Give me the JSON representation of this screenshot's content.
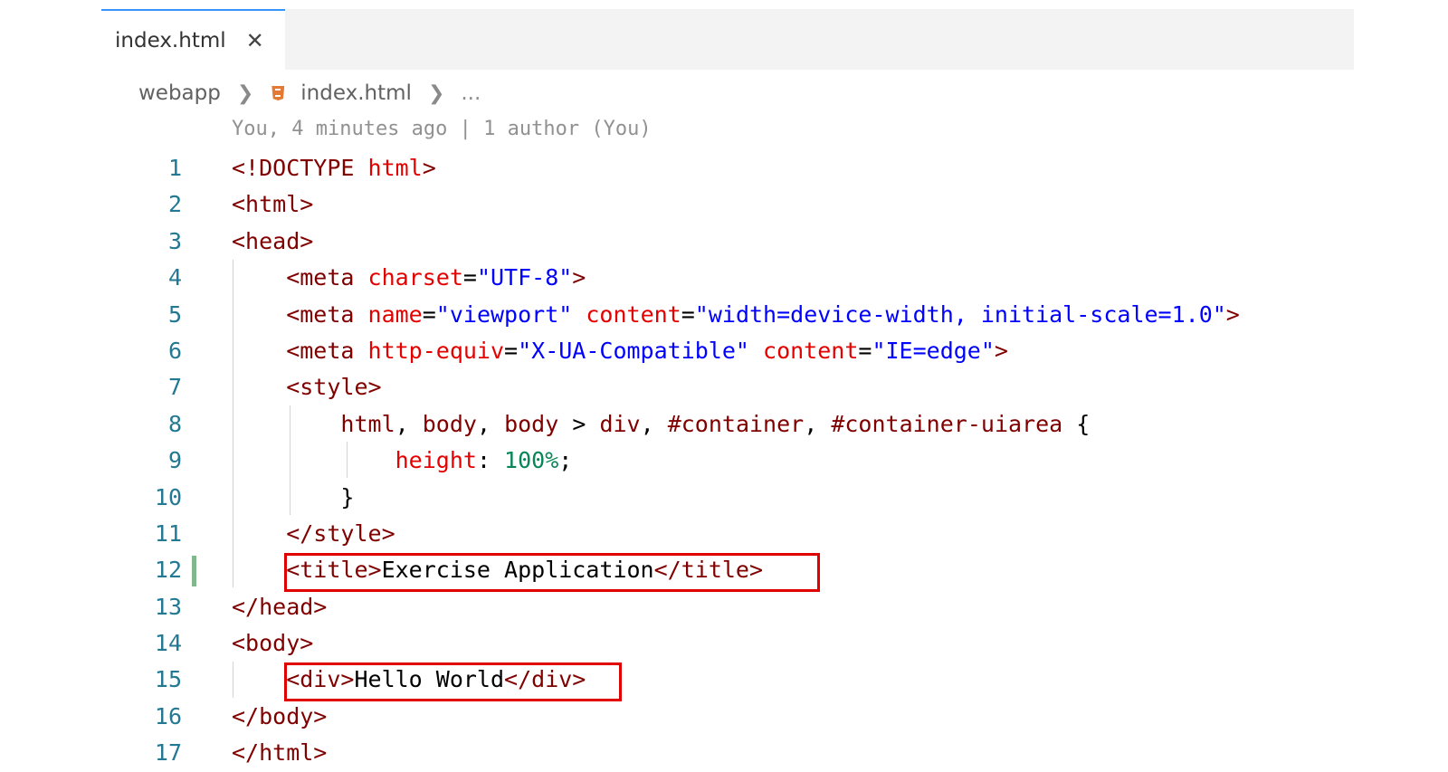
{
  "tab": {
    "label": "index.html",
    "close": "✕"
  },
  "breadcrumb": {
    "folder": "webapp",
    "file": "index.html",
    "more": "..."
  },
  "blame": "You, 4 minutes ago | 1 author (You)",
  "colors": {
    "tag": "#800000",
    "attribute": "#e50000",
    "string": "#0000ff",
    "number": "#098658",
    "line_number": "#237893",
    "highlight_box": "#e00000",
    "modified_gutter": "#81b88b",
    "active_tab_border": "#3794ff"
  },
  "lines": [
    {
      "n": "1",
      "tokens": [
        {
          "t": "<!DOCTYPE ",
          "c": "tag"
        },
        {
          "t": "html",
          "c": "attr"
        },
        {
          "t": ">",
          "c": "tag"
        }
      ]
    },
    {
      "n": "2",
      "tokens": [
        {
          "t": "<html>",
          "c": "tag"
        }
      ]
    },
    {
      "n": "3",
      "tokens": [
        {
          "t": "<head>",
          "c": "tag"
        }
      ]
    },
    {
      "n": "4",
      "tokens": [
        {
          "t": "    <meta ",
          "c": "tag"
        },
        {
          "t": "charset",
          "c": "attr"
        },
        {
          "t": "=",
          "c": "txt"
        },
        {
          "t": "\"UTF-8\"",
          "c": "str"
        },
        {
          "t": ">",
          "c": "tag"
        }
      ]
    },
    {
      "n": "5",
      "tokens": [
        {
          "t": "    <meta ",
          "c": "tag"
        },
        {
          "t": "name",
          "c": "attr"
        },
        {
          "t": "=",
          "c": "txt"
        },
        {
          "t": "\"viewport\"",
          "c": "str"
        },
        {
          "t": " ",
          "c": "txt"
        },
        {
          "t": "content",
          "c": "attr"
        },
        {
          "t": "=",
          "c": "txt"
        },
        {
          "t": "\"width=device-width, initial-scale=1.0\"",
          "c": "str"
        },
        {
          "t": ">",
          "c": "tag"
        }
      ]
    },
    {
      "n": "6",
      "tokens": [
        {
          "t": "    <meta ",
          "c": "tag"
        },
        {
          "t": "http-equiv",
          "c": "attr"
        },
        {
          "t": "=",
          "c": "txt"
        },
        {
          "t": "\"X-UA-Compatible\"",
          "c": "str"
        },
        {
          "t": " ",
          "c": "txt"
        },
        {
          "t": "content",
          "c": "attr"
        },
        {
          "t": "=",
          "c": "txt"
        },
        {
          "t": "\"IE=edge\"",
          "c": "str"
        },
        {
          "t": ">",
          "c": "tag"
        }
      ]
    },
    {
      "n": "7",
      "tokens": [
        {
          "t": "    <style>",
          "c": "tag"
        }
      ]
    },
    {
      "n": "8",
      "tokens": [
        {
          "t": "        html",
          "c": "sel"
        },
        {
          "t": ", ",
          "c": "txt"
        },
        {
          "t": "body",
          "c": "sel"
        },
        {
          "t": ", ",
          "c": "txt"
        },
        {
          "t": "body",
          "c": "sel"
        },
        {
          "t": " > ",
          "c": "txt"
        },
        {
          "t": "div",
          "c": "sel"
        },
        {
          "t": ", ",
          "c": "txt"
        },
        {
          "t": "#container",
          "c": "sel"
        },
        {
          "t": ", ",
          "c": "txt"
        },
        {
          "t": "#container-uiarea",
          "c": "sel"
        },
        {
          "t": " {",
          "c": "txt"
        }
      ]
    },
    {
      "n": "9",
      "tokens": [
        {
          "t": "            height",
          "c": "attr"
        },
        {
          "t": ": ",
          "c": "txt"
        },
        {
          "t": "100%",
          "c": "num"
        },
        {
          "t": ";",
          "c": "txt"
        }
      ]
    },
    {
      "n": "10",
      "tokens": [
        {
          "t": "        }",
          "c": "txt"
        }
      ]
    },
    {
      "n": "11",
      "tokens": [
        {
          "t": "    </style>",
          "c": "tag"
        }
      ]
    },
    {
      "n": "12",
      "modified": true,
      "tokens": [
        {
          "t": "    <title>",
          "c": "tag"
        },
        {
          "t": "Exercise Application",
          "c": "txt"
        },
        {
          "t": "</title>",
          "c": "tag"
        }
      ]
    },
    {
      "n": "13",
      "tokens": [
        {
          "t": "</head>",
          "c": "tag"
        }
      ]
    },
    {
      "n": "14",
      "tokens": [
        {
          "t": "<body>",
          "c": "tag"
        }
      ]
    },
    {
      "n": "15",
      "tokens": [
        {
          "t": "    <div>",
          "c": "tag"
        },
        {
          "t": "Hello World",
          "c": "txt"
        },
        {
          "t": "</div>",
          "c": "tag"
        }
      ]
    },
    {
      "n": "16",
      "tokens": [
        {
          "t": "</body>",
          "c": "tag"
        }
      ]
    },
    {
      "n": "17",
      "tokens": [
        {
          "t": "</html>",
          "c": "tag"
        }
      ]
    }
  ]
}
